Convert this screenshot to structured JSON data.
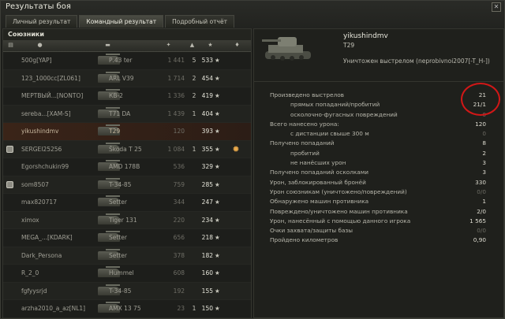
{
  "window": {
    "title": "Результаты боя",
    "close_icon": "close-icon"
  },
  "tabs": [
    {
      "label": "Личный результат",
      "active": false
    },
    {
      "label": "Командный результат",
      "active": true
    },
    {
      "label": "Подробный отчёт",
      "active": false
    }
  ],
  "allies": {
    "title": "Союзники",
    "columns_icons": [
      "squad-icon",
      "player-icon",
      "tank-icon",
      "damage-icon",
      "kills-icon",
      "xp-icon",
      "achievement-icon"
    ],
    "rows": [
      {
        "name": "500g[YAP]",
        "vehicle": "Р.43 ter",
        "damage": "1 441",
        "kills": "5",
        "xp": "533",
        "platoon": "",
        "self": false
      },
      {
        "name": "123_1000cc[ZL061]",
        "vehicle": "ARL V39",
        "damage": "1 714",
        "kills": "2",
        "xp": "454",
        "platoon": "",
        "self": false
      },
      {
        "name": "МЕРТВЫЙ...[NONTO]",
        "vehicle": "КВ-2",
        "damage": "1 336",
        "kills": "2",
        "xp": "419",
        "platoon": "",
        "self": false
      },
      {
        "name": "sereba...[XAM-S]",
        "vehicle": "T71 DA",
        "damage": "1 439",
        "kills": "1",
        "xp": "404",
        "platoon": "",
        "self": false
      },
      {
        "name": "yikushindmv",
        "vehicle": "T29",
        "damage": "120",
        "kills": "",
        "xp": "393",
        "platoon": "",
        "self": true
      },
      {
        "name": "SERGEI25256",
        "vehicle": "Škoda T 25",
        "damage": "1 084",
        "kills": "1",
        "xp": "355",
        "platoon": "",
        "self": false
      },
      {
        "name": "Egorshchukin99",
        "vehicle": "AMD 178B",
        "damage": "536",
        "kills": "",
        "xp": "329",
        "platoon": "",
        "self": false
      },
      {
        "name": "som8507",
        "vehicle": "T-34-85",
        "damage": "759",
        "kills": "",
        "xp": "285",
        "platoon": "",
        "self": false
      },
      {
        "name": "max820717",
        "vehicle": "Setter",
        "damage": "344",
        "kills": "",
        "xp": "247",
        "platoon": "",
        "self": false
      },
      {
        "name": "ximox",
        "vehicle": "Tiger 131",
        "damage": "220",
        "kills": "",
        "xp": "234",
        "platoon": "",
        "self": false
      },
      {
        "name": "MEGA_...[KDARK]",
        "vehicle": "Setter",
        "damage": "656",
        "kills": "",
        "xp": "218",
        "platoon": "",
        "self": false
      },
      {
        "name": "Dark_Persona",
        "vehicle": "Setter",
        "damage": "378",
        "kills": "",
        "xp": "182",
        "platoon": "",
        "self": false
      },
      {
        "name": "R_2_0",
        "vehicle": "Hummel",
        "damage": "608",
        "kills": "",
        "xp": "160",
        "platoon": "",
        "self": false
      },
      {
        "name": "fgfyysrjd",
        "vehicle": "T-34-85",
        "damage": "192",
        "kills": "",
        "xp": "155",
        "platoon": "",
        "self": false
      },
      {
        "name": "arzha2010_a_az[NL1]",
        "vehicle": "AMX 13 75",
        "damage": "23",
        "kills": "1",
        "xp": "150",
        "platoon": "",
        "self": false
      }
    ]
  },
  "player": {
    "name": "yikushindmv",
    "tank": "T29",
    "status": "Уничтожен выстрелом (neprobivnoi2007[-T_H-])",
    "tank_icon": "t29-tank-icon"
  },
  "stats": [
    {
      "label": "Произведено выстрелов",
      "value": "21",
      "indent": false,
      "dim": false
    },
    {
      "label": "прямых попаданий/пробитий",
      "value": "21/1",
      "indent": true,
      "dim": false
    },
    {
      "label": "осколочно-фугасных повреждений",
      "value": "0",
      "indent": true,
      "dim": true
    },
    {
      "label": "Всего нанесено урона:",
      "value": "120",
      "indent": false,
      "dim": false
    },
    {
      "label": "с дистанции свыше 300 м",
      "value": "0",
      "indent": true,
      "dim": true
    },
    {
      "label": "Получено попаданий",
      "value": "8",
      "indent": false,
      "dim": false
    },
    {
      "label": "пробитий",
      "value": "2",
      "indent": true,
      "dim": false
    },
    {
      "label": "не нанёсших урон",
      "value": "3",
      "indent": true,
      "dim": false
    },
    {
      "label": "Получено попаданий осколками",
      "value": "3",
      "indent": false,
      "dim": false
    },
    {
      "label": "Урон, заблокированный бронёй",
      "value": "330",
      "indent": false,
      "dim": false
    },
    {
      "label": "Урон союзникам (уничтожено/повреждений)",
      "value": "0/0",
      "indent": false,
      "dim": true
    },
    {
      "label": "Обнаружено машин противника",
      "value": "1",
      "indent": false,
      "dim": false
    },
    {
      "label": "Повреждено/уничтожено машин противника",
      "value": "2/0",
      "indent": false,
      "dim": false
    },
    {
      "label": "Урон, нанесённый с помощью данного игрока",
      "value": "1 565",
      "indent": false,
      "dim": false
    },
    {
      "label": "Очки захвата/защиты базы",
      "value": "0/0",
      "indent": false,
      "dim": true
    },
    {
      "label": "Пройдено километров",
      "value": "0,90",
      "indent": false,
      "dim": false
    }
  ],
  "colors": {
    "highlight_circle": "#d21717",
    "self_row": "#3a2418"
  }
}
